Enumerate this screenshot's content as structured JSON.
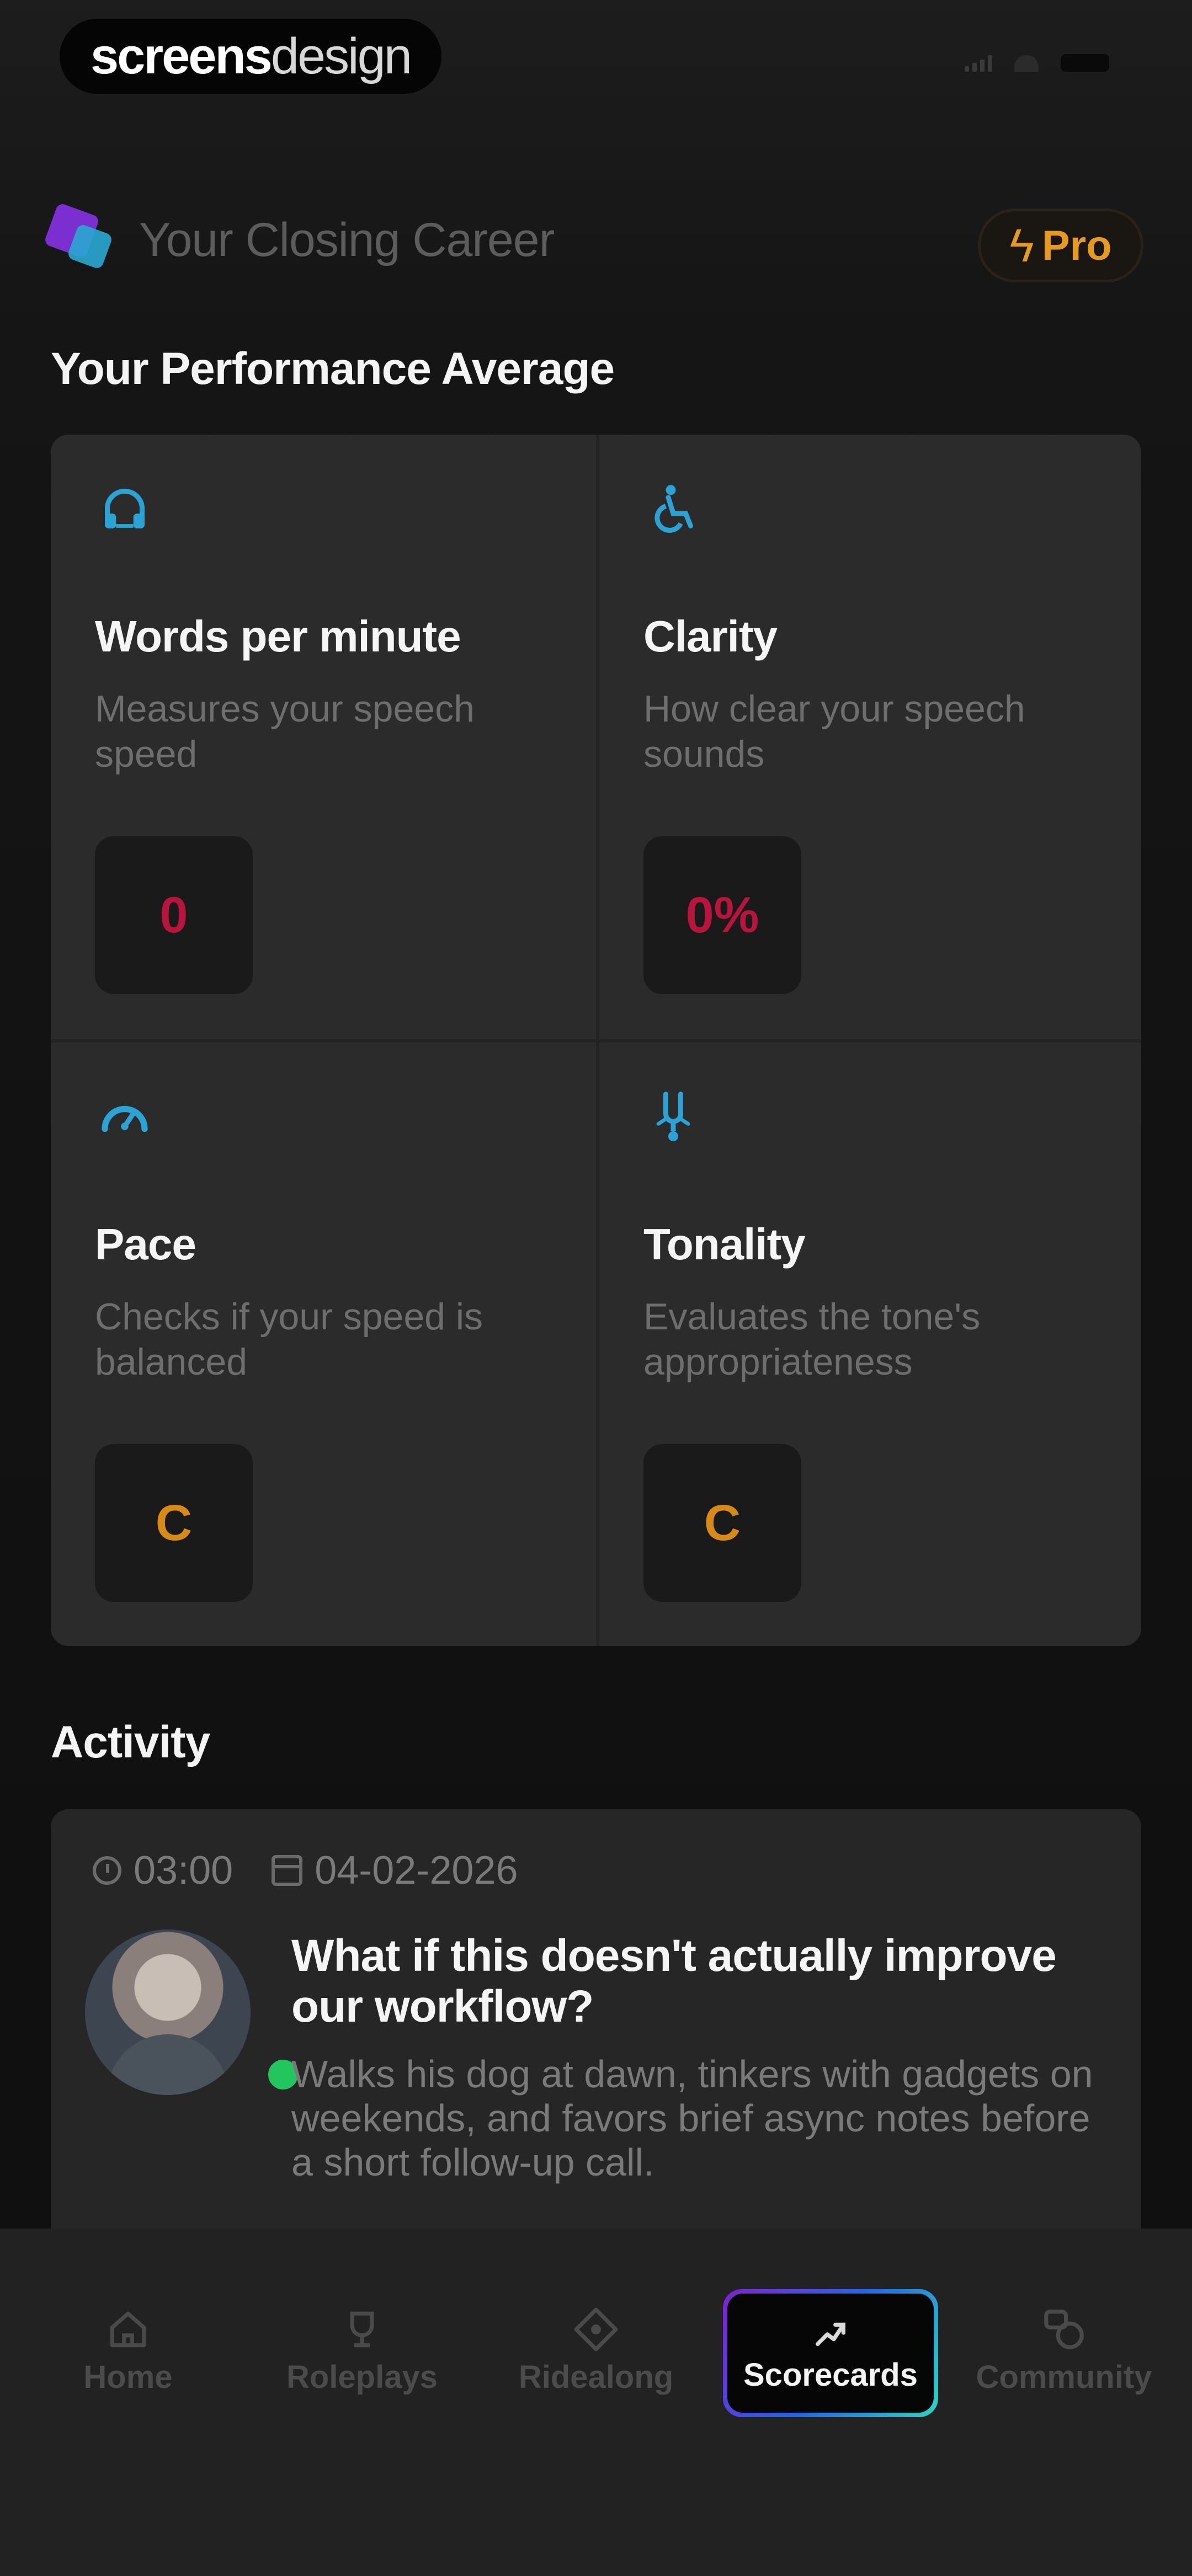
{
  "status_bar": {
    "watermark_bold": "screens",
    "watermark_light": "design"
  },
  "header": {
    "title": "Your Closing Career",
    "pro_label": "Pro",
    "pro_icon": "lightning-icon"
  },
  "performance": {
    "title": "Your Performance Average",
    "metrics": [
      {
        "icon": "headset-icon",
        "title": "Words per minute",
        "description": "Measures your speech speed",
        "value": "0",
        "value_color": "#b8143e"
      },
      {
        "icon": "accessibility-icon",
        "title": "Clarity",
        "description": "How clear your speech sounds",
        "value": "0%",
        "value_color": "#b8143e"
      },
      {
        "icon": "gauge-icon",
        "title": "Pace",
        "description": "Checks if your speed is balanced",
        "value": "C",
        "value_color": "#d88a16"
      },
      {
        "icon": "tuning-fork-icon",
        "title": "Tonality",
        "description": "Evaluates the tone's appropriateness",
        "value": "C",
        "value_color": "#d88a16"
      }
    ]
  },
  "activity": {
    "title": "Activity",
    "items": [
      {
        "duration": "03:00",
        "date": "04-02-2026",
        "title": "What if this doesn't actually improve our workflow?",
        "description": "Walks his dog at dawn, tinkers with gadgets on weekends, and favors brief async notes before a short follow-up call.",
        "online": true
      }
    ]
  },
  "nav": {
    "items": [
      {
        "label": "Home",
        "icon": "home-icon"
      },
      {
        "label": "Roleplays",
        "icon": "trophy-icon"
      },
      {
        "label": "Ridealong",
        "icon": "compass-icon"
      },
      {
        "label": "Scorecards",
        "icon": "trend-up-icon",
        "active": true
      },
      {
        "label": "Community",
        "icon": "community-icon"
      }
    ]
  },
  "colors": {
    "background": "#121212",
    "card": "#2b2b2b",
    "accent_icon": "#2ba3d4",
    "score_red": "#b8143e",
    "score_orange": "#d88a16",
    "pro_orange": "#e79a22",
    "online_green": "#22c55e"
  }
}
